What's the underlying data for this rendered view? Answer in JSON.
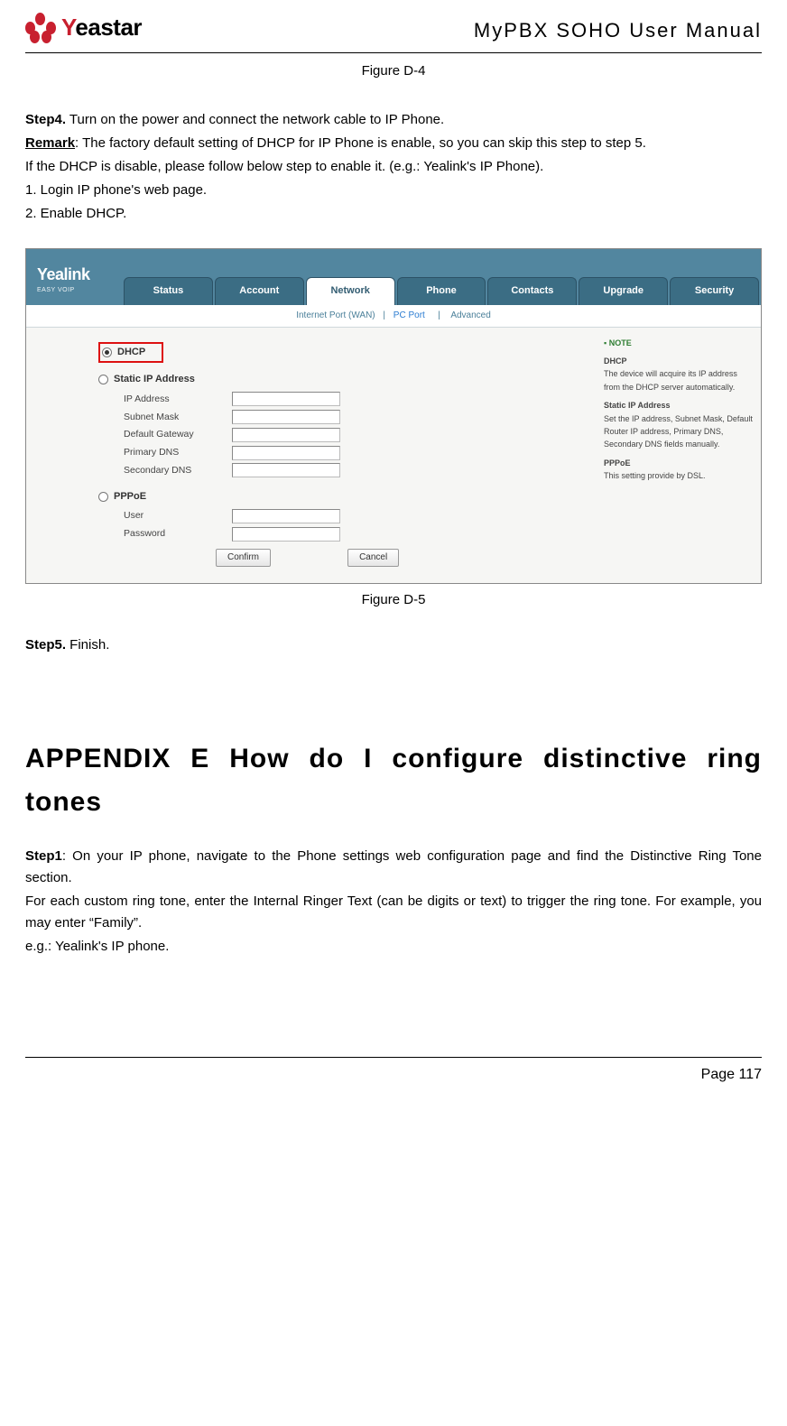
{
  "header": {
    "brand_pre": "Y",
    "brand_post": "eastar",
    "doc_title": "MyPBX SOHO User Manual"
  },
  "fig_d4": "Figure D-4",
  "step4": {
    "label": "Step4.",
    "text": " Turn on the power and connect the network cable to IP Phone."
  },
  "remark": {
    "label": "Remark",
    "text": ": The factory default setting of DHCP for IP Phone is enable, so you can skip this step to step 5."
  },
  "para1": "If the DHCP is disable, please follow below step to enable it. (e.g.: Yealink's IP Phone).",
  "list1": "1. Login IP phone's web page.",
  "list2": "2. Enable DHCP.",
  "screenshot": {
    "logo": "Yealink",
    "logo_sub": "EASY VOIP",
    "tabs": [
      "Status",
      "Account",
      "Network",
      "Phone",
      "Contacts",
      "Upgrade",
      "Security"
    ],
    "subbar": {
      "wan": "Internet Port (WAN)",
      "pc": "PC Port",
      "adv": "Advanced"
    },
    "radios": {
      "dhcp": "DHCP",
      "static": "Static IP Address",
      "pppoe": "PPPoE"
    },
    "fields": {
      "ip": "IP Address",
      "mask": "Subnet Mask",
      "gw": "Default Gateway",
      "pdns": "Primary DNS",
      "sdns": "Secondary DNS",
      "user": "User",
      "pass": "Password"
    },
    "buttons": {
      "confirm": "Confirm",
      "cancel": "Cancel"
    },
    "note": {
      "header": "NOTE",
      "dhcp_h": "DHCP",
      "dhcp_t": "The device will acquire its IP address from the DHCP server automatically.",
      "static_h": "Static IP Address",
      "static_t": "Set the IP address, Subnet Mask, Default Router IP address, Primary DNS, Secondary DNS fields manually.",
      "pppoe_h": "PPPoE",
      "pppoe_t": "This setting provide by DSL."
    }
  },
  "fig_d5": "Figure D-5",
  "step5": {
    "label": "Step5.",
    "text": " Finish."
  },
  "appendix_title": "APPENDIX E How do I configure distinctive ring tones",
  "appE": {
    "step1_label": "Step1",
    "step1_text": ": On your IP phone, navigate to the Phone settings web configuration page and find the Distinctive Ring Tone section.",
    "p2": "For each custom ring tone, enter the Internal Ringer Text (can be digits or text) to trigger the ring tone. For example, you may enter “Family”.",
    "p3": "e.g.: Yealink's IP phone."
  },
  "footer": {
    "page": "Page 117"
  }
}
